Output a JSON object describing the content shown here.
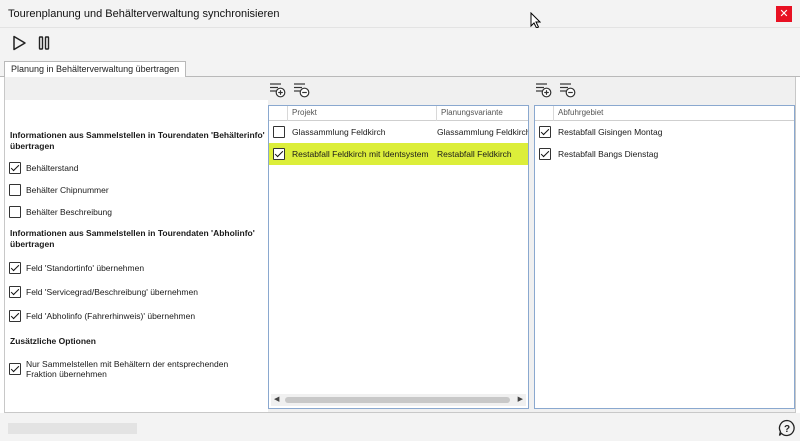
{
  "window": {
    "title": "Tourenplanung und Behälterverwaltung synchronisieren",
    "close_label": "✕"
  },
  "toolbar": {
    "play_icon": "play-icon",
    "pause_icon": "pause-icon"
  },
  "tabs": [
    {
      "label": "Planung in Behälterverwaltung übertragen",
      "active": true
    }
  ],
  "options": {
    "section1_title": "Informationen aus Sammelstellen in Tourendaten 'Behälterinfo' übertragen",
    "section1_items": [
      {
        "label": "Behälterstand",
        "checked": true
      },
      {
        "label": "Behälter Chipnummer",
        "checked": false
      },
      {
        "label": "Behälter Beschreibung",
        "checked": false
      }
    ],
    "section2_title": "Informationen aus Sammelstellen in Tourendaten 'Abholinfo' übertragen",
    "section2_items": [
      {
        "label": "Feld 'Standortinfo' übernehmen",
        "checked": true
      },
      {
        "label": "Feld 'Servicegrad/Beschreibung' übernehmen",
        "checked": true
      },
      {
        "label": "Feld 'Abholinfo (Fahrerhinweis)' übernehmen",
        "checked": true
      }
    ],
    "section3_title": "Zusätzliche Optionen",
    "section3_items": [
      {
        "label": "Nur Sammelstellen mit Behältern der entsprechenden Fraktion übernehmen",
        "checked": true
      }
    ]
  },
  "projects_grid": {
    "columns": [
      "Projekt",
      "Planungsvariante"
    ],
    "rows": [
      {
        "checked": false,
        "selected": false,
        "projekt": "Glassammlung Feldkirch",
        "planungsvariante": "Glassammlung Feldkirch"
      },
      {
        "checked": true,
        "selected": true,
        "projekt": "Restabfall Feldkirch mit Identsystem",
        "planungsvariante": "Restabfall Feldkirch"
      }
    ],
    "add_icon": "add-rows-icon",
    "remove_icon": "remove-rows-icon",
    "selected_color": "#dcee3a"
  },
  "areas_grid": {
    "columns": [
      "Abfuhrgebiet"
    ],
    "rows": [
      {
        "checked": true,
        "abfuhrgebiet": "Restabfall Gisingen Montag"
      },
      {
        "checked": true,
        "abfuhrgebiet": "Restabfall Bangs Dienstag"
      }
    ],
    "add_icon": "add-rows-icon",
    "remove_icon": "remove-rows-icon"
  },
  "statusbar": {
    "help_icon": "help-icon"
  },
  "colors": {
    "close": "#e81123",
    "grid_border": "#8aa8cf"
  }
}
